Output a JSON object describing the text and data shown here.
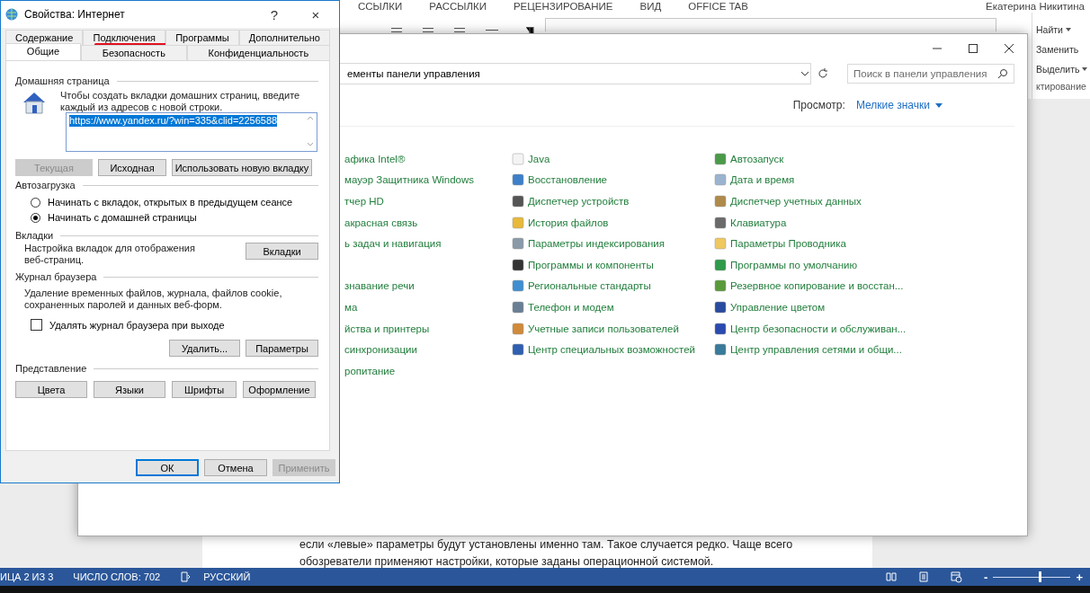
{
  "word": {
    "ribbon_tabs": [
      "ССЫЛКИ",
      "РАССЫЛКИ",
      "РЕЦЕНЗИРОВАНИЕ",
      "ВИД",
      "OFFICE TAB"
    ],
    "user": "Екатерина Никитина",
    "editing": [
      {
        "label": "Найти",
        "caret": true
      },
      {
        "label": "Заменить",
        "caret": false
      },
      {
        "label": "Выделить",
        "caret": true
      }
    ],
    "editing_group": "ктирование",
    "body_lines": [
      "если «левые» параметры будут установлены именно там. Такое случается редко. Чаще всего",
      "обозреватели применяют настройки, которые заданы операционной системой."
    ],
    "status_bar": {
      "items": [
        "ИЦА 2 ИЗ 3",
        "ЧИСЛО СЛОВ: 702",
        "РУССКИЙ"
      ],
      "zoom_out": "-",
      "zoom_in": "+",
      "zoom": {
        "level": 0.6
      }
    }
  },
  "control_panel": {
    "address": "ементы панели управления",
    "search": {
      "placeholder": "Поиск в панели управления"
    },
    "view_label": "Просмотр:",
    "view_value": "Мелкие значки",
    "columns": [
      {
        "kind": "cut",
        "items": [
          {
            "label": "афика Intel®"
          },
          {
            "label": "мауэр Защитника Windows"
          },
          {
            "label": "тчер HD"
          },
          {
            "label": "акрасная связь"
          },
          {
            "label": "ь задач и навигация"
          },
          {
            "label": "знавание речи",
            "gap_before": true
          },
          {
            "label": "ма"
          },
          {
            "label": "йства и принтеры"
          },
          {
            "label": " синхронизации"
          },
          {
            "label": "ропитание"
          }
        ]
      },
      {
        "kind": "full",
        "items": [
          {
            "label": "Java",
            "color": "#f4f4f4"
          },
          {
            "label": "Восстановление",
            "color": "#3d7fc9"
          },
          {
            "label": "Диспетчер устройств",
            "color": "#555555"
          },
          {
            "label": "История файлов",
            "color": "#e8b93a"
          },
          {
            "label": "Параметры индексирования",
            "color": "#8a9aa8"
          },
          {
            "label": "Программы и компоненты",
            "color": "#333333"
          },
          {
            "label": "Региональные стандарты",
            "color": "#3f8fd0"
          },
          {
            "label": "Телефон и модем",
            "color": "#6a7f95"
          },
          {
            "label": "Учетные записи пользователей",
            "color": "#d08a3a"
          },
          {
            "label": "Центр специальных возможностей",
            "color": "#2f5fb0"
          }
        ]
      },
      {
        "kind": "full",
        "items": [
          {
            "label": "Автозапуск",
            "color": "#4a9a4a"
          },
          {
            "label": "Дата и время",
            "color": "#9ab4d0"
          },
          {
            "label": "Диспетчер учетных данных",
            "color": "#b08a4a"
          },
          {
            "label": "Клавиатура",
            "color": "#6a6a6a"
          },
          {
            "label": "Параметры Проводника",
            "color": "#f0c860"
          },
          {
            "label": "Программы по умолчанию",
            "color": "#2f9a4a"
          },
          {
            "label": "Резервное копирование и восстан...",
            "color": "#5a9a3a"
          },
          {
            "label": "Управление цветом",
            "color": "#2a4aa0"
          },
          {
            "label": "Центр безопасности и обслуживан...",
            "color": "#2a4ab0"
          },
          {
            "label": "Центр управления сетями и общи...",
            "color": "#3a7a9a"
          }
        ]
      }
    ]
  },
  "dialog": {
    "title": "Свойства: Интернет",
    "help": "?",
    "close": "×",
    "tab_rows": [
      [
        {
          "label": "Содержание",
          "selected": false,
          "marked": false
        },
        {
          "label": "Подключения",
          "selected": false,
          "marked": true
        },
        {
          "label": "Программы",
          "selected": false,
          "marked": false
        },
        {
          "label": "Дополнительно",
          "selected": false,
          "marked": false
        }
      ],
      [
        {
          "label": "Общие",
          "selected": true,
          "marked": false
        },
        {
          "label": "Безопасность",
          "selected": false,
          "marked": false
        },
        {
          "label": "Конфиденциальность",
          "selected": false,
          "marked": false
        }
      ]
    ],
    "home": {
      "heading": "Домашняя страница",
      "hint": "Чтобы создать вкладки домашних страниц, введите каждый из адресов с новой строки.",
      "value": "https://www.yandex.ru/?win=335&clid=2256588",
      "buttons": [
        {
          "label": "Текущая",
          "disabled": true
        },
        {
          "label": "Исходная",
          "disabled": false
        },
        {
          "label": "Использовать новую вкладку",
          "disabled": false
        }
      ]
    },
    "startup": {
      "heading": "Автозагрузка",
      "options": [
        {
          "label": "Начинать с вкладок, открытых в предыдущем сеансе",
          "selected": false
        },
        {
          "label": "Начинать с домашней страницы",
          "selected": true
        }
      ]
    },
    "tabs_group": {
      "heading": "Вкладки",
      "text": "Настройка вкладок для отображения веб-страниц.",
      "button": "Вкладки"
    },
    "history": {
      "heading": "Журнал браузера",
      "text": "Удаление временных файлов, журнала, файлов cookie, сохраненных паролей и данных веб-форм.",
      "checkbox": {
        "label": "Удалять журнал браузера при выходе",
        "checked": false
      },
      "buttons": [
        "Удалить...",
        "Параметры"
      ]
    },
    "appearance": {
      "heading": "Представление",
      "buttons": [
        "Цвета",
        "Языки",
        "Шрифты",
        "Оформление"
      ]
    },
    "footer": [
      {
        "label": "ОК",
        "kind": "default",
        "disabled": false
      },
      {
        "label": "Отмена",
        "kind": "normal",
        "disabled": false
      },
      {
        "label": "Применить",
        "kind": "normal",
        "disabled": true
      }
    ]
  }
}
